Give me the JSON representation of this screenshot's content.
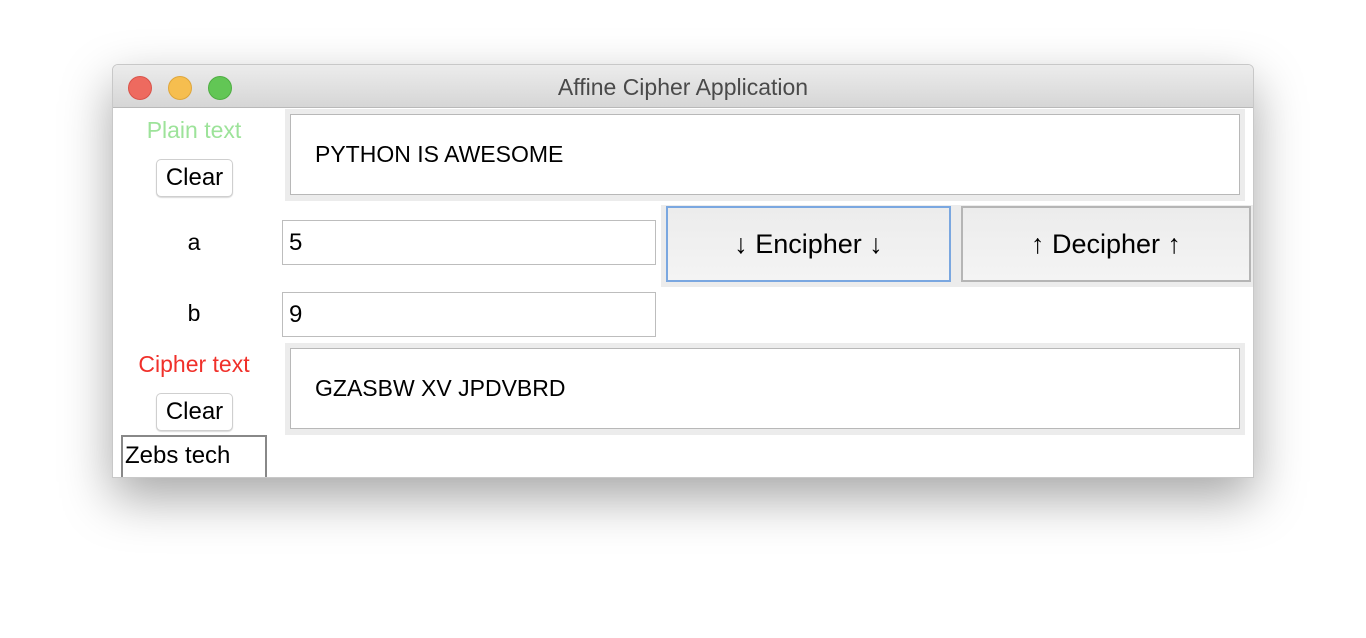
{
  "window": {
    "title": "Affine Cipher Application"
  },
  "plain": {
    "label": "Plain text",
    "label_color": "#9de39a",
    "clear_label": "Clear",
    "value": "PYTHON IS AWESOME"
  },
  "key": {
    "a_label": "a",
    "a_value": "5",
    "b_label": "b",
    "b_value": "9"
  },
  "actions": {
    "encipher_label": "↓ Encipher ↓",
    "decipher_label": "↑ Decipher ↑",
    "focus_color": "#7aa7e0"
  },
  "cipher": {
    "label": "Cipher text",
    "label_color": "#f0302a",
    "clear_label": "Clear",
    "value": "GZASBW XV JPDVBRD"
  },
  "footer": {
    "credit": "Zebs tech"
  }
}
